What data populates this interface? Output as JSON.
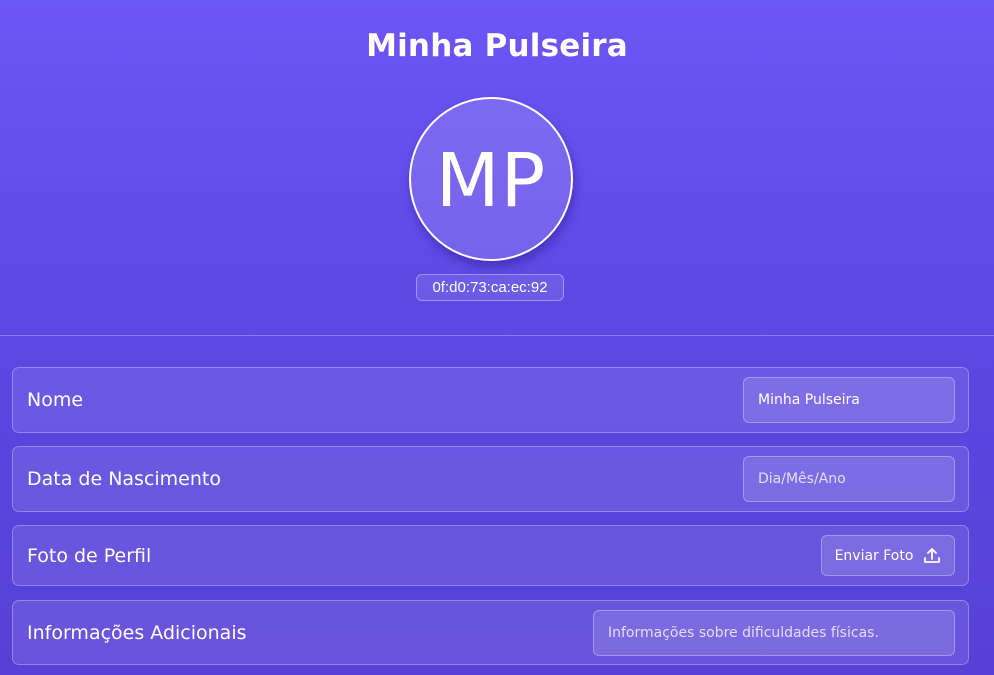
{
  "app": {
    "title": "Minha Pulseira",
    "avatar_initials": "MP",
    "device_id": "0f:d0:73:ca:ec:92"
  },
  "form": {
    "nome": {
      "label": "Nome",
      "value": "Minha Pulseira",
      "placeholder": ""
    },
    "data_nascimento": {
      "label": "Data de Nascimento",
      "value": "",
      "placeholder": "Dia/Mês/Ano"
    },
    "foto_perfil": {
      "label": "Foto de Perfil",
      "button_label": "Enviar Foto",
      "button_icon": "upload-icon"
    },
    "info_adicionais": {
      "label": "Informações Adicionais",
      "value": "",
      "placeholder": "Informações sobre dificuldades físicas."
    }
  },
  "colors": {
    "background_top": "#6e55f7",
    "background_bottom": "#5840d6",
    "text": "#ffffff"
  }
}
